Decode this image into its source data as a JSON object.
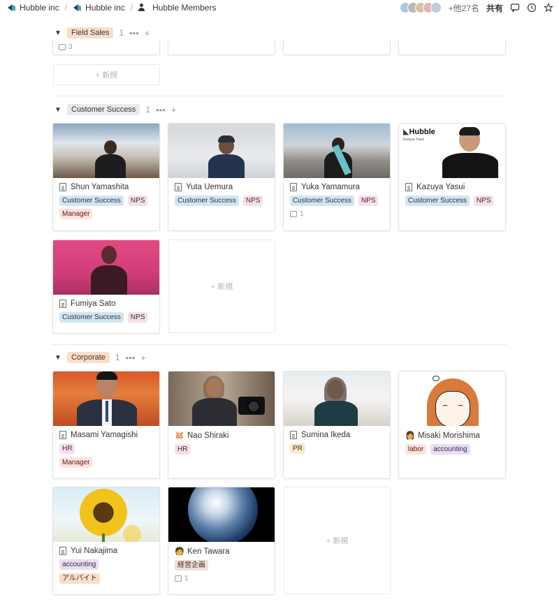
{
  "breadcrumb": {
    "items": [
      "Hubble inc",
      "Hubble inc",
      "Hubble Members"
    ],
    "separator": "/"
  },
  "topbar": {
    "more_members": "+他27名",
    "share": "共有"
  },
  "new_label": "+ 新規",
  "groups": {
    "field_sales": {
      "name": "Field Sales",
      "count": "1",
      "color": "#fadec9"
    },
    "customer_success": {
      "name": "Customer Success",
      "count": "1",
      "color": "#e9e9e7"
    },
    "corporate": {
      "name": "Corporate",
      "count": "1",
      "color": "#fadec9"
    }
  },
  "field_sales_partial": {
    "comment_count": "3"
  },
  "cs_cards": [
    {
      "name": "Shun Yamashita",
      "tags": [
        "Customer Success",
        "NPS",
        "Manager"
      ]
    },
    {
      "name": "Yuta Uemura",
      "tags": [
        "Customer Success",
        "NPS"
      ]
    },
    {
      "name": "Yuka Yamamura",
      "tags": [
        "Customer Success",
        "NPS"
      ],
      "comments": "1"
    },
    {
      "name": "Kazuya Yasui",
      "tags": [
        "Customer Success",
        "NPS"
      ],
      "cover_brand": "Hubble",
      "cover_sub": "Kazuya Yasui"
    },
    {
      "name": "Fumiya Sato",
      "tags": [
        "Customer Success",
        "NPS"
      ]
    }
  ],
  "corp_cards": [
    {
      "name": "Masami Yamagishi",
      "tags": [
        "HR",
        "Manager"
      ]
    },
    {
      "name": "Nao Shiraki",
      "icon": "🐹",
      "tags": [
        "HR"
      ]
    },
    {
      "name": "Sumina Ikeda",
      "tags": [
        "PR"
      ]
    },
    {
      "name": "Misaki Morishima",
      "icon": "👩",
      "tags": [
        "labor",
        "accounting"
      ]
    },
    {
      "name": "Yui Nakajima",
      "tags": [
        "accounting",
        "アルバイト"
      ]
    },
    {
      "name": "Ken Tawara",
      "icon": "🧑",
      "tags": [
        "経営企画"
      ],
      "comments": "1"
    }
  ]
}
